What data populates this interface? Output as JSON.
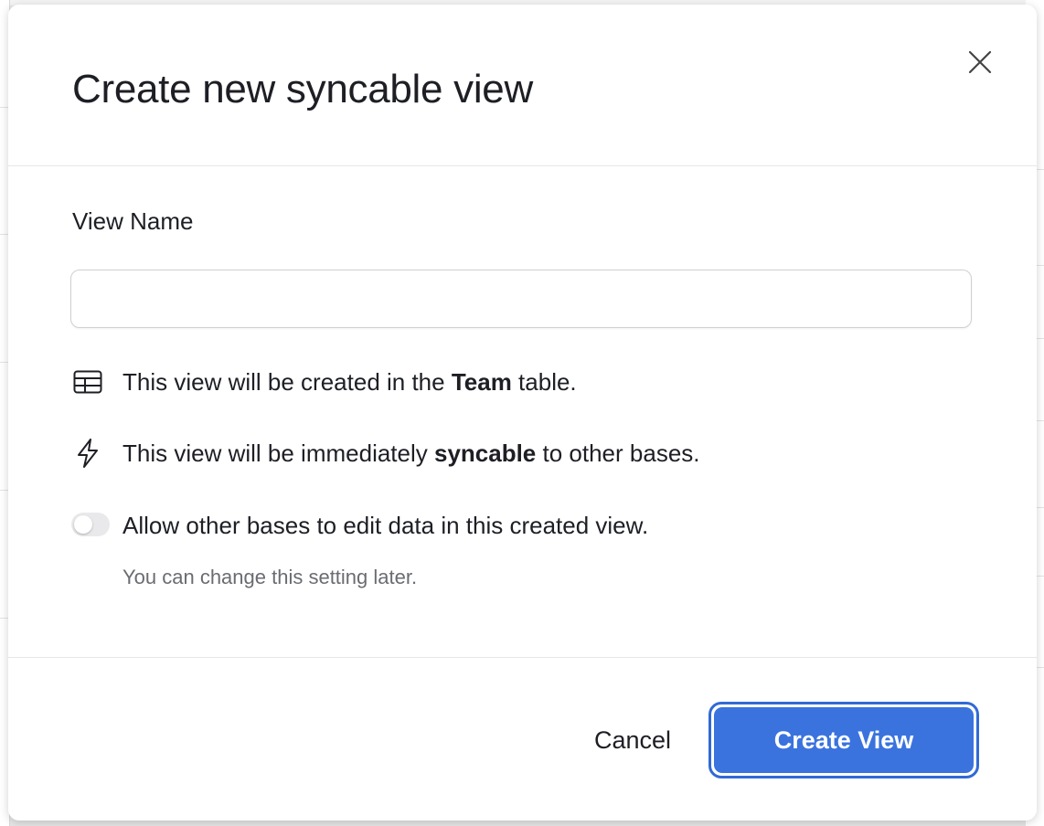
{
  "dialog": {
    "title": "Create new syncable view",
    "close_icon": "close-icon",
    "field_label": "View Name",
    "name_value": "",
    "info_table": {
      "icon": "table-icon",
      "prefix": "This view will be created in the ",
      "bold": "Team",
      "suffix": " table."
    },
    "info_sync": {
      "icon": "lightning-bolt-icon",
      "prefix": "This view will be immediately ",
      "bold": "syncable",
      "suffix": " to other bases."
    },
    "toggle": {
      "label": "Allow other bases to edit data in this created view.",
      "enabled": false
    },
    "hint": "You can change this setting later.",
    "cancel_label": "Cancel",
    "create_label": "Create View"
  },
  "colors": {
    "primary": "#3a73de",
    "primary_border": "#3169d6",
    "text": "#1d1f25",
    "muted": "#6a6c72"
  }
}
